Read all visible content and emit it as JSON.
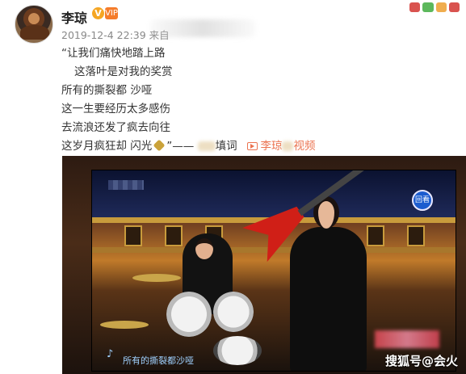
{
  "post": {
    "username": "李琼",
    "verified_badge": "V",
    "vip_icon": "VIP",
    "meta": "2019-12-4 22:39 来自",
    "lines": [
      "“让我们痛快地踏上路",
      "这落叶是对我的奖赏",
      "所有的撕裂都 沙哑",
      "这一生要经历太多感伤",
      "去流浪还发了疯去向往"
    ],
    "last_line_prefix": "这岁月疯狂却 闪光",
    "last_line_quote_end": "”——",
    "last_line_suffix": "填词",
    "video_link_name": "李琼",
    "video_link_suffix": "视频"
  },
  "video": {
    "subtitle": "所有的撕裂都沙哑",
    "corner_badge": "回看",
    "watermark": "搜狐号@会火"
  },
  "icons": {
    "avatar": "avatar-image",
    "link": "video-link-icon",
    "sparkle": "sparkle-emoji",
    "note": "music-note-icon"
  },
  "colors": {
    "link": "#eb7350",
    "meta": "#888888",
    "username": "#222222"
  }
}
